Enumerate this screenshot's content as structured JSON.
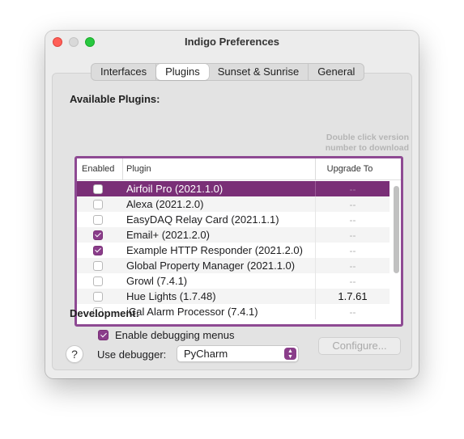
{
  "window": {
    "title": "Indigo Preferences"
  },
  "tabs": [
    {
      "label": "Interfaces",
      "active": false
    },
    {
      "label": "Plugins",
      "active": true
    },
    {
      "label": "Sunset & Sunrise",
      "active": false
    },
    {
      "label": "General",
      "active": false
    }
  ],
  "plugins_section": {
    "heading": "Available Plugins:",
    "hint": "Double click version number to download",
    "columns": {
      "enabled": "Enabled",
      "plugin": "Plugin",
      "upgrade": "Upgrade To"
    },
    "rows": [
      {
        "enabled": false,
        "name": "Airfoil Pro (2021.1.0)",
        "upgrade": "--",
        "selected": true
      },
      {
        "enabled": false,
        "name": "Alexa (2021.2.0)",
        "upgrade": "--"
      },
      {
        "enabled": false,
        "name": "EasyDAQ Relay Card (2021.1.1)",
        "upgrade": "--"
      },
      {
        "enabled": true,
        "name": "Email+ (2021.2.0)",
        "upgrade": "--"
      },
      {
        "enabled": true,
        "name": "Example HTTP Responder (2021.2.0)",
        "upgrade": "--"
      },
      {
        "enabled": false,
        "name": "Global Property Manager (2021.1.0)",
        "upgrade": "--"
      },
      {
        "enabled": false,
        "name": "Growl (7.4.1)",
        "upgrade": "--"
      },
      {
        "enabled": false,
        "name": "Hue Lights (1.7.48)",
        "upgrade": "1.7.61"
      },
      {
        "enabled": false,
        "name": "iCal Alarm Processor (7.4.1)",
        "upgrade": "--"
      }
    ]
  },
  "configure_button": "Configure...",
  "development": {
    "heading": "Development:",
    "debug_menus_label": "Enable debugging menus",
    "debug_menus_checked": true,
    "debugger_label": "Use debugger:",
    "debugger_value": "PyCharm"
  },
  "help_label": "?",
  "colors": {
    "accent": "#7a2f77",
    "close": "#ff5f57",
    "zoom": "#28c840"
  }
}
